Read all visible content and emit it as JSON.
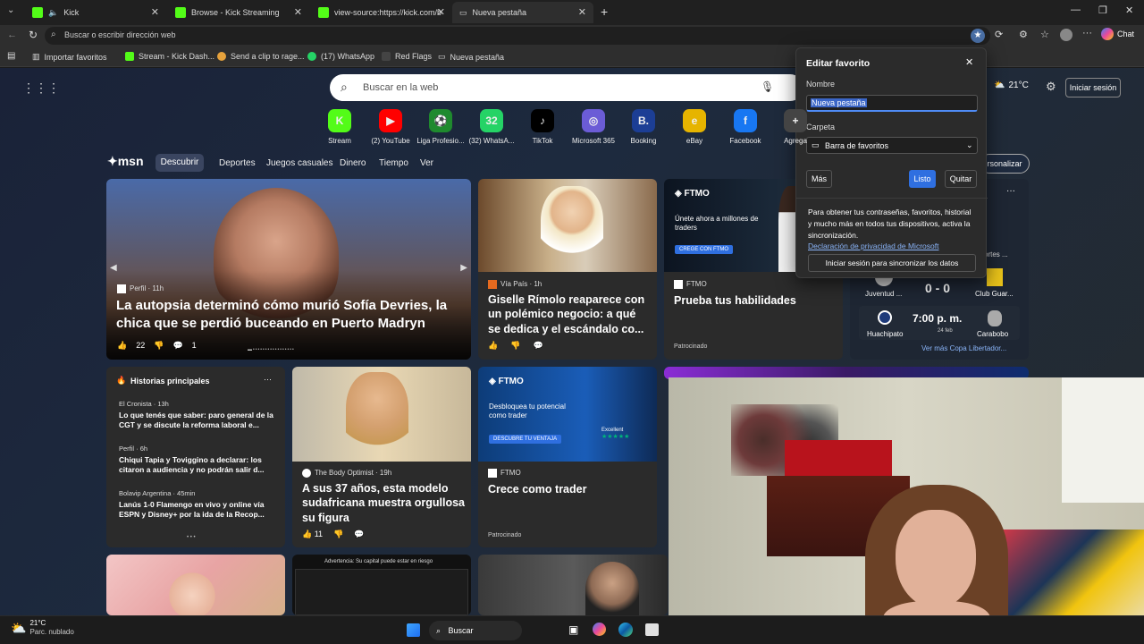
{
  "tabs": [
    {
      "label": "Kick"
    },
    {
      "label": "Browse - Kick Streaming"
    },
    {
      "label": "view-source:https://kick.com/brow"
    },
    {
      "label": "Nueva pestaña"
    }
  ],
  "address": {
    "placeholder": "Buscar o escribir dirección web",
    "chat": "Chat"
  },
  "bookmarks": [
    {
      "label": "Importar favoritos"
    },
    {
      "label": "Stream - Kick Dash..."
    },
    {
      "label": "Send a clip to rage..."
    },
    {
      "label": "(17) WhatsApp"
    },
    {
      "label": "Red Flags"
    },
    {
      "label": "Nueva pestaña"
    }
  ],
  "search": {
    "placeholder": "Buscar en la web"
  },
  "quick_links": [
    {
      "label": "Stream",
      "icon": "K",
      "color": "#53fc18"
    },
    {
      "label": "(2) YouTube",
      "icon": "▶",
      "color": "#ff0000"
    },
    {
      "label": "Liga Profesio...",
      "icon": "⚽",
      "color": "#1f8a2e"
    },
    {
      "label": "(32) WhatsA...",
      "icon": "32",
      "color": "#25d366"
    },
    {
      "label": "TikTok",
      "icon": "♪",
      "color": "#000000"
    },
    {
      "label": "Microsoft 365",
      "icon": "◎",
      "color": "#6b5cd6"
    },
    {
      "label": "Booking",
      "icon": "B.",
      "color": "#1c3e95"
    },
    {
      "label": "eBay",
      "icon": "e",
      "color": "#e6b400"
    },
    {
      "label": "Facebook",
      "icon": "f",
      "color": "#1877f2"
    },
    {
      "label": "Agrega",
      "icon": "+",
      "color": "#444444"
    }
  ],
  "weather_top": {
    "temp": "21°C",
    "signin": "Iniciar sesión"
  },
  "msn": {
    "logo": "msn",
    "nav": [
      "Descubrir",
      "Deportes",
      "Juegos casuales",
      "Dinero",
      "Tiempo",
      "Ver"
    ],
    "personalize": "rsonalizar"
  },
  "hero": {
    "source": "Perfil · 11h",
    "title": "La autopsia determinó cómo murió Sofía Devries, la chica que se perdió buceando en Puerto Madryn",
    "likes": "22",
    "comments": "1"
  },
  "card2": {
    "source": "Vía País · 1h",
    "title": "Giselle Rímolo reaparece con un polémico negocio: a qué se dedica y el escándalo co..."
  },
  "ftmo1": {
    "brand": "FTMO",
    "line1": "Únete ahora a millones de traders",
    "cta": "CREGE CON FTMO",
    "source": "FTMO",
    "title": "Prueba tus habilidades",
    "sponsored": "Patrocinado"
  },
  "sports": {
    "team1": "Juventud ...",
    "score": "0 - 0",
    "team2": "Club Guar...",
    "team3": "Huachipato",
    "time": "7:00 p. m.",
    "date": "24 feb",
    "team4": "Carabobo",
    "more": "Ver más Copa Libertador...",
    "partial": "ortes ..."
  },
  "top_stories": {
    "title": "Historias principales",
    "items": [
      {
        "source": "El Cronista · 13h",
        "title": "Lo que tenés que saber: paro general de la CGT y se discute la reforma laboral e..."
      },
      {
        "source": "Perfil · 6h",
        "title": "Chiqui Tapia y Toviggino a declarar: los citaron a audiencia y no podrán salir d..."
      },
      {
        "source": "Bolavip Argentina · 45min",
        "title": "Lanús 1-0 Flamengo en vivo y online vía ESPN y Disney+ por la ida de la Recop..."
      }
    ]
  },
  "card_model": {
    "source": "The Body Optimist · 19h",
    "title": "A sus 37 años, esta modelo sudafricana muestra orgullosa su figura",
    "likes": "11"
  },
  "ftmo2": {
    "brand": "FTMO",
    "line1": "Desbloquea tu potencial como trader",
    "cta": "DESCUBRE TU VENTAJA",
    "rating": "Excellent",
    "source": "FTMO",
    "title": "Crece como trader",
    "sponsored": "Patrocinado"
  },
  "ad_strip": "Advertencia: Su capital puede estar en riesgo",
  "dialog": {
    "title": "Editar favorito",
    "name_label": "Nombre",
    "name_value": "Nueva pestaña",
    "folder_label": "Carpeta",
    "folder_value": "Barra de favoritos",
    "more": "Más",
    "done": "Listo",
    "remove": "Quitar",
    "sync_text": "Para obtener tus contraseñas, favoritos, historial y mucho más en todos tus dispositivos, activa la sincronización.",
    "privacy": "Declaración de privacidad de Microsoft",
    "sync_button": "Iniciar sesión para sincronizar los datos"
  },
  "taskbar": {
    "temp": "21°C",
    "weather": "Parc. nublado",
    "search": "Buscar"
  }
}
